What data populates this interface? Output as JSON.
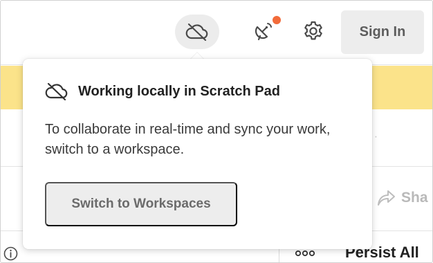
{
  "header": {
    "cloud_off_icon": "cloud-off-icon",
    "satellite_icon": "satellite-dish-icon",
    "notification_color": "#f26b3a",
    "settings_icon": "gear-icon",
    "sign_in_label": "Sign In"
  },
  "banner": {
    "color": "#fbe38a"
  },
  "background": {
    "share_label": "Sha",
    "share_icon": "share-arrow-icon",
    "more_icon": "more-horizontal-icon",
    "persist_label": "Persist All",
    "info_icon": "info-icon"
  },
  "popover": {
    "icon": "cloud-off-icon",
    "title": "Working locally in Scratch Pad",
    "body": "To collaborate in real-time and sync your work, switch to a workspace.",
    "button_label": "Switch to Workspaces"
  }
}
